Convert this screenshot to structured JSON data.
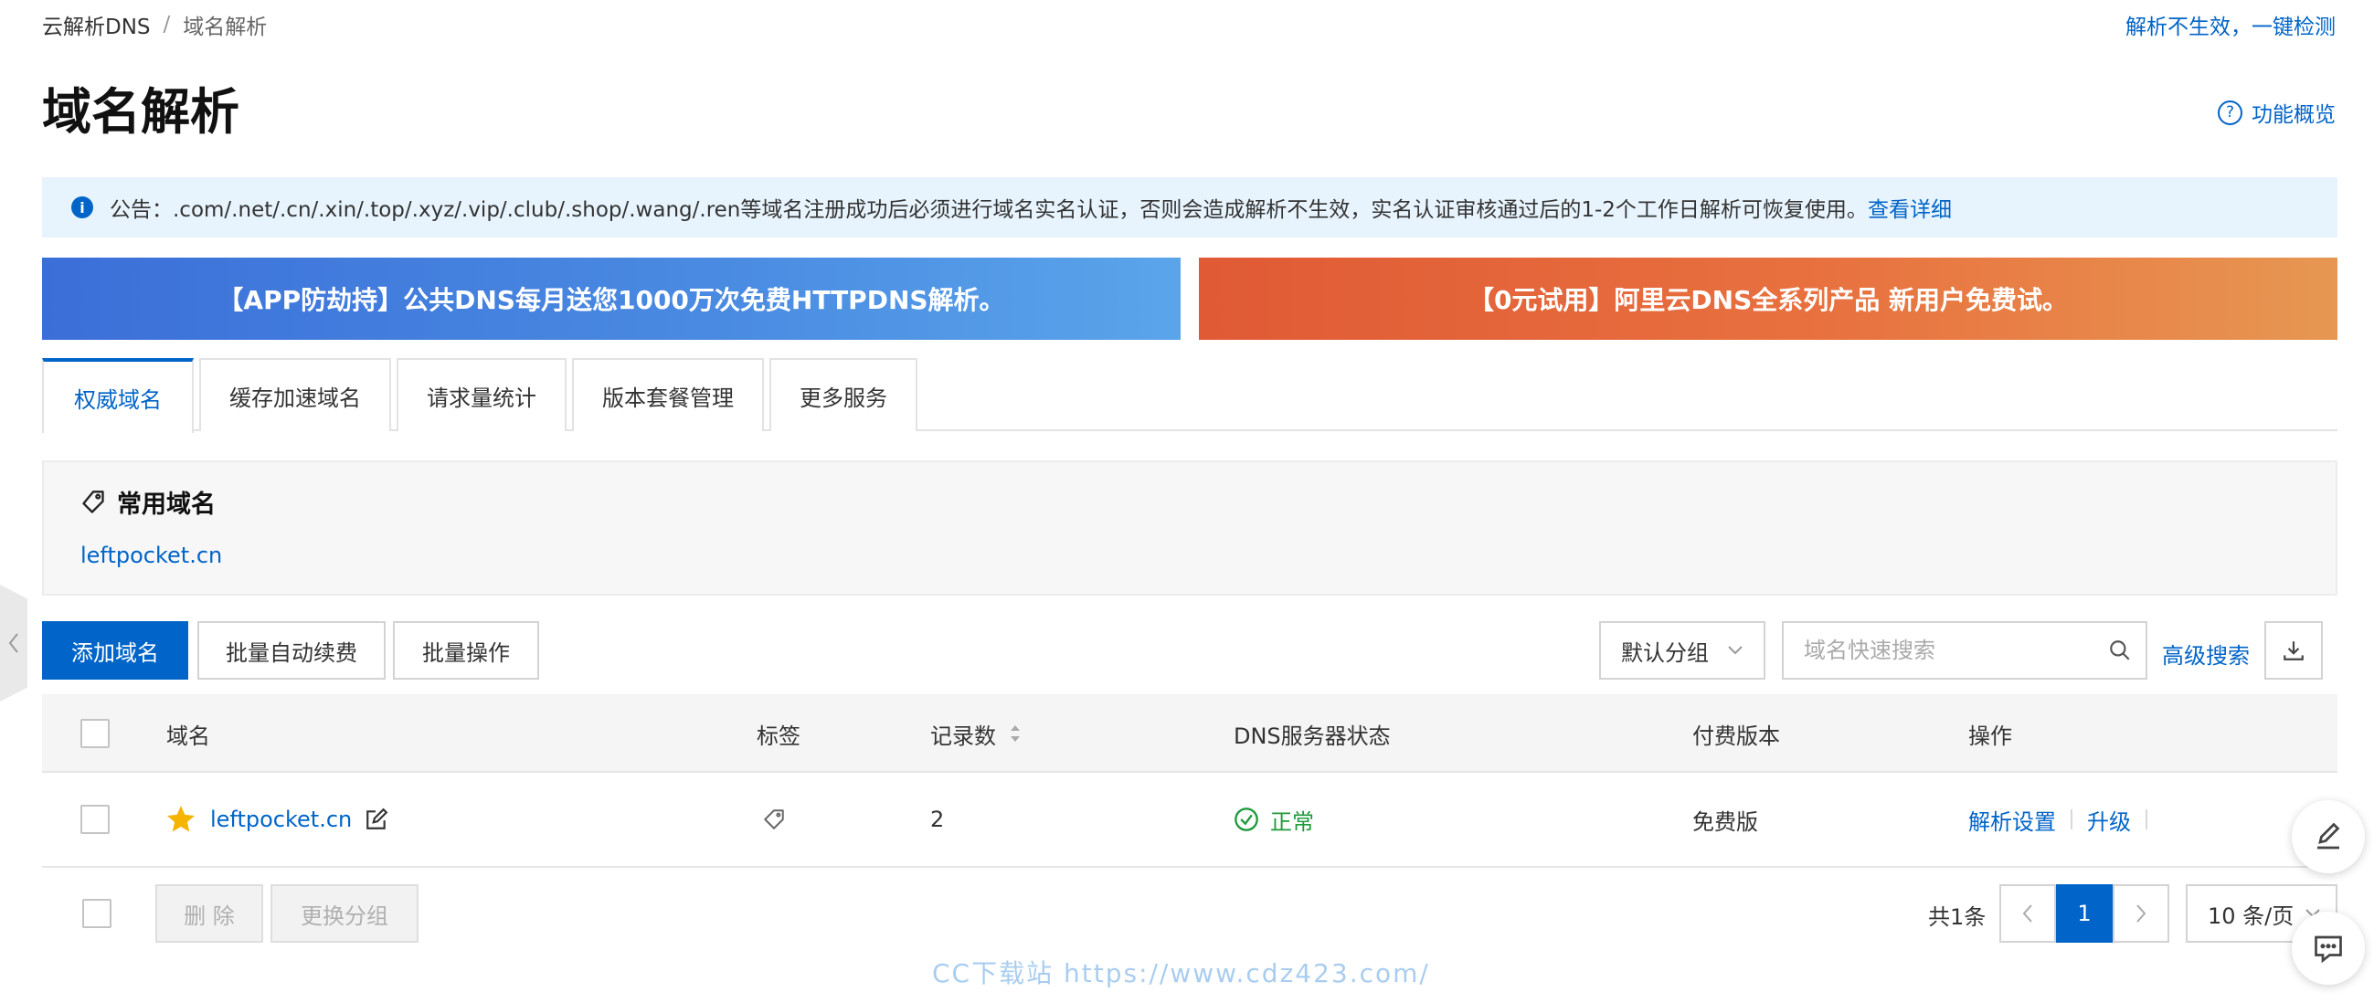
{
  "breadcrumb": {
    "root": "云解析DNS",
    "separator": "/",
    "current": "域名解析"
  },
  "header": {
    "check_link": "解析不生效，一键检测",
    "title": "域名解析",
    "overview_link": "功能概览"
  },
  "notice": {
    "icon": "info-icon",
    "text": "公告：.com/.net/.cn/.xin/.top/.xyz/.vip/.club/.shop/.wang/.ren等域名注册成功后必须进行域名实名认证，否则会造成解析不生效，实名认证审核通过后的1-2个工作日解析可恢复使用。",
    "link": "查看详细"
  },
  "banners": {
    "left": "【APP防劫持】公共DNS每月送您1000万次免费HTTPDNS解析。",
    "right": "【0元试用】阿里云DNS全系列产品 新用户免费试。"
  },
  "tabs": [
    {
      "label": "权威域名",
      "active": true
    },
    {
      "label": "缓存加速域名"
    },
    {
      "label": "请求量统计"
    },
    {
      "label": "版本套餐管理"
    },
    {
      "label": "更多服务"
    }
  ],
  "common_domains": {
    "title": "常用域名",
    "items": [
      "leftpocket.cn"
    ]
  },
  "toolbar": {
    "add_button": "添加域名",
    "batch_renew_button": "批量自动续费",
    "batch_ops_button": "批量操作",
    "group_select": "默认分组",
    "search_placeholder": "域名快速搜索",
    "advanced_search": "高级搜索"
  },
  "table": {
    "headers": {
      "domain": "域名",
      "tag": "标签",
      "records": "记录数",
      "dns_status": "DNS服务器状态",
      "edition": "付费版本",
      "actions": "操作"
    },
    "rows": [
      {
        "domain": "leftpocket.cn",
        "records": "2",
        "dns_status": "正常",
        "edition": "免费版",
        "action_settings": "解析设置",
        "action_upgrade": "升级"
      }
    ]
  },
  "footer": {
    "delete_button": "删 除",
    "change_group_button": "更换分组",
    "total": "共1条",
    "current_page": "1",
    "page_size": "10 条/页"
  },
  "watermark": "CC下载站  https://www.cdz423.com/",
  "colors": {
    "accent": "#0064c8",
    "notice_bg": "#e8f4fd",
    "success": "#1e9b3a",
    "banner_left": "#3b6fd8",
    "banner_right": "#e05a35",
    "star": "#f5b400"
  }
}
